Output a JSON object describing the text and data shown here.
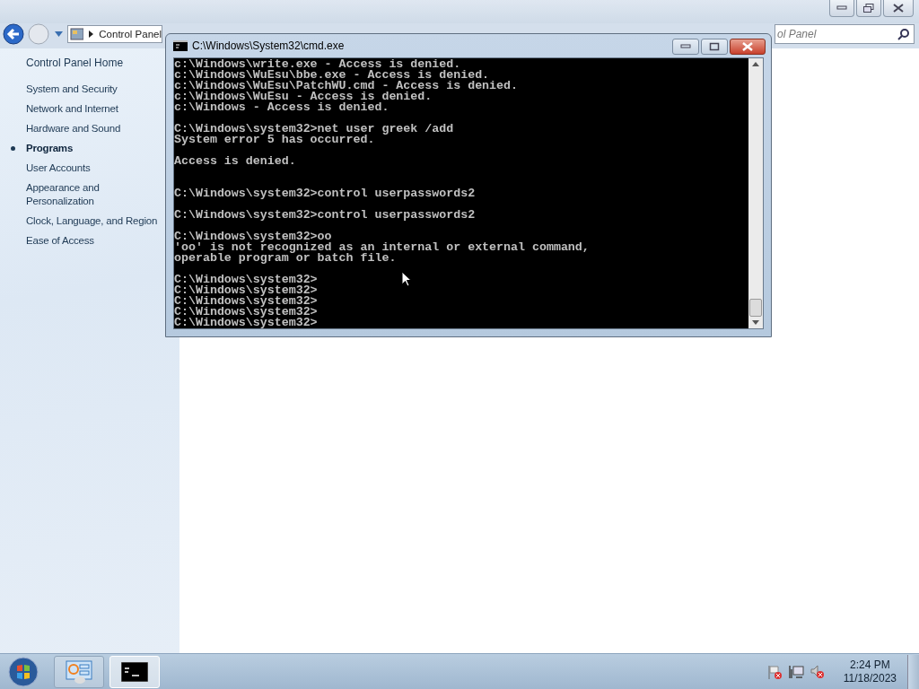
{
  "control_panel": {
    "address": "Control Panel",
    "search": {
      "placeholder": "ol Panel"
    },
    "sidebar": {
      "home": "Control Panel Home",
      "items": [
        {
          "label": "System and Security",
          "selected": false
        },
        {
          "label": "Network and Internet",
          "selected": false
        },
        {
          "label": "Hardware and Sound",
          "selected": false
        },
        {
          "label": "Programs",
          "selected": true
        },
        {
          "label": "User Accounts",
          "selected": false
        },
        {
          "label": "Appearance and Personalization",
          "selected": false
        },
        {
          "label": "Clock, Language, and Region",
          "selected": false
        },
        {
          "label": "Ease of Access",
          "selected": false
        }
      ]
    }
  },
  "cmd_window": {
    "title": "C:\\Windows\\System32\\cmd.exe",
    "lines": [
      {
        "kind": "text",
        "text": "c:\\Windows\\write.exe - Access is denied."
      },
      {
        "kind": "text",
        "text": "c:\\Windows\\WuEsu\\bbe.exe - Access is denied."
      },
      {
        "kind": "text",
        "text": "c:\\Windows\\WuEsu\\PatchWU.cmd - Access is denied."
      },
      {
        "kind": "text",
        "text": "c:\\Windows\\WuEsu - Access is denied."
      },
      {
        "kind": "text",
        "text": "c:\\Windows - Access is denied."
      },
      {
        "kind": "blank"
      },
      {
        "kind": "text",
        "text": "C:\\Windows\\system32>net user greek /add"
      },
      {
        "kind": "text",
        "text": "System error 5 has occurred."
      },
      {
        "kind": "blank"
      },
      {
        "kind": "text",
        "text": "Access is denied."
      },
      {
        "kind": "blank"
      },
      {
        "kind": "blank"
      },
      {
        "kind": "text",
        "text": "C:\\Windows\\system32>control userpasswords2"
      },
      {
        "kind": "blank"
      },
      {
        "kind": "text",
        "text": "C:\\Windows\\system32>control userpasswords2"
      },
      {
        "kind": "blank"
      },
      {
        "kind": "text",
        "text": "C:\\Windows\\system32>oo"
      },
      {
        "kind": "text",
        "text": "'oo' is not recognized as an internal or external command,"
      },
      {
        "kind": "text",
        "text": "operable program or batch file."
      },
      {
        "kind": "blank"
      },
      {
        "kind": "text",
        "text": "C:\\Windows\\system32>"
      },
      {
        "kind": "text",
        "text": "C:\\Windows\\system32>"
      },
      {
        "kind": "text",
        "text": "C:\\Windows\\system32>"
      },
      {
        "kind": "text",
        "text": "C:\\Windows\\system32>"
      },
      {
        "kind": "text",
        "text": "C:\\Windows\\system32>"
      }
    ]
  },
  "taskbar": {
    "buttons": [
      {
        "kind": "control-panel",
        "selected": false
      },
      {
        "kind": "cmd",
        "selected": true
      }
    ],
    "time": "2:24 PM",
    "date": "11/18/2023"
  }
}
